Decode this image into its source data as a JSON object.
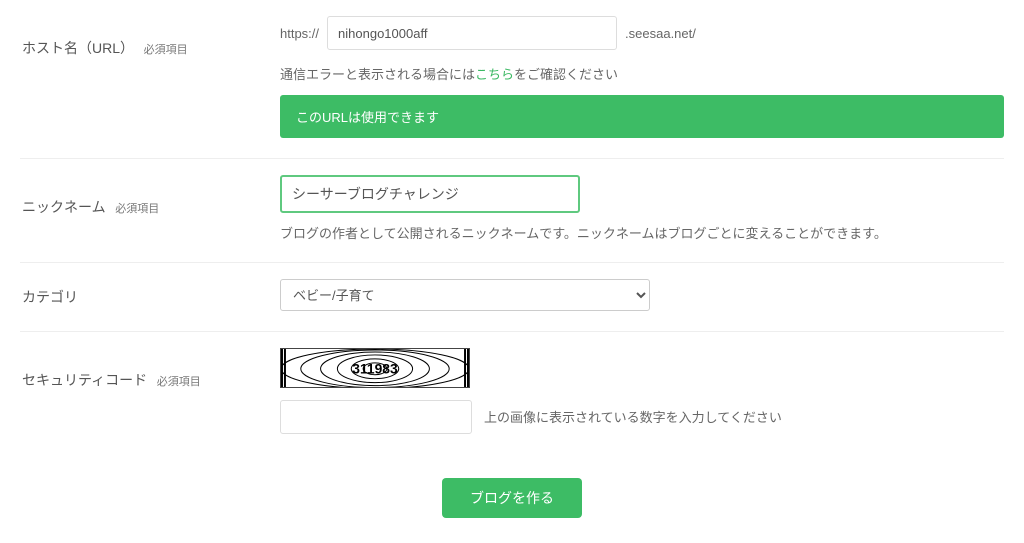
{
  "hostname": {
    "label": "ホスト名（URL）",
    "required": "必須項目",
    "prefix": "https://",
    "value": "nihongo1000aff",
    "suffix": ".seesaa.net/",
    "note_before": "通信エラーと表示される場合には",
    "note_link": "こちら",
    "note_after": "をご確認ください",
    "success": "このURLは使用できます"
  },
  "nickname": {
    "label": "ニックネーム",
    "required": "必須項目",
    "value": "シーサーブログチャレンジ",
    "help": "ブログの作者として公開されるニックネームです。ニックネームはブログごとに変えることができます。"
  },
  "category": {
    "label": "カテゴリ",
    "selected": "ベビー/子育て"
  },
  "security": {
    "label": "セキュリティコード",
    "required": "必須項目",
    "captcha_text": "311983",
    "help": "上の画像に表示されている数字を入力してください"
  },
  "submit": {
    "label": "ブログを作る"
  }
}
